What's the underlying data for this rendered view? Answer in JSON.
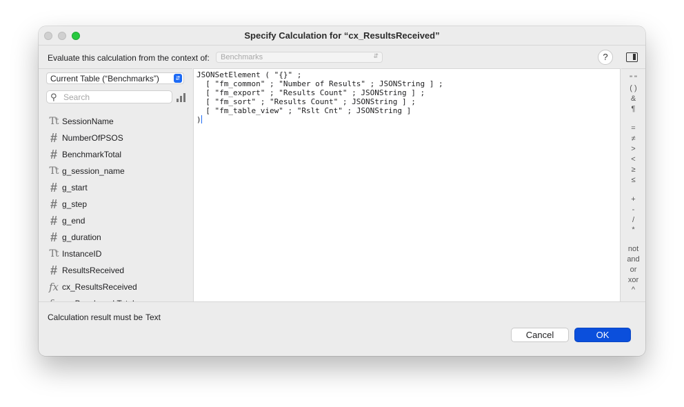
{
  "window": {
    "title": "Specify Calculation for “cx_ResultsReceived”"
  },
  "context": {
    "label": "Evaluate this calculation from the context of:",
    "selected": "Benchmarks"
  },
  "toolbar": {
    "help_label": "?"
  },
  "sidebar": {
    "table_select": "Current Table (“Benchmarks”)",
    "search": {
      "placeholder": "Search",
      "value": ""
    },
    "fields": [
      {
        "name": "SessionName",
        "type": "text",
        "icon": "text-type-icon"
      },
      {
        "name": "NumberOfPSOS",
        "type": "number",
        "icon": "number-type-icon"
      },
      {
        "name": "BenchmarkTotal",
        "type": "number",
        "icon": "number-type-icon"
      },
      {
        "name": "g_session_name",
        "type": "text",
        "icon": "text-type-icon"
      },
      {
        "name": "g_start",
        "type": "number",
        "icon": "number-type-icon"
      },
      {
        "name": "g_step",
        "type": "number",
        "icon": "number-type-icon"
      },
      {
        "name": "g_end",
        "type": "number",
        "icon": "number-type-icon"
      },
      {
        "name": "g_duration",
        "type": "number",
        "icon": "number-type-icon"
      },
      {
        "name": "InstanceID",
        "type": "text",
        "icon": "text-type-icon"
      },
      {
        "name": "ResultsReceived",
        "type": "number",
        "icon": "number-type-icon"
      },
      {
        "name": "cx_ResultsReceived",
        "type": "calc",
        "icon": "calculation-type-icon"
      },
      {
        "name": "cx_BenchmarkTotal",
        "type": "calc",
        "icon": "calculation-type-icon"
      }
    ],
    "type_glyphs": {
      "text": "Tt",
      "number": "#",
      "calc": "fx"
    }
  },
  "editor": {
    "lines": [
      "JSONSetElement ( \"{}\" ;",
      "  [ \"fm_common\" ; \"Number of Results\" ; JSONString ] ;",
      "  [ \"fm_export\" ; \"Results Count\" ; JSONString ] ;",
      "  [ \"fm_sort\" ; \"Results Count\" ; JSONString ] ;",
      "  [ \"fm_table_view\" ; \"Rslt Cnt\" ; JSONString ]",
      ")"
    ]
  },
  "operators": [
    "\" \"",
    "( )",
    "&",
    "¶",
    "=",
    "≠",
    ">",
    "<",
    "≥",
    "≤",
    "+",
    "-",
    "/",
    "*",
    "not",
    "and",
    "or",
    "xor",
    "^"
  ],
  "footer": {
    "result_label": "Calculation result must be",
    "result_type": "Text",
    "cancel_label": "Cancel",
    "ok_label": "OK"
  }
}
